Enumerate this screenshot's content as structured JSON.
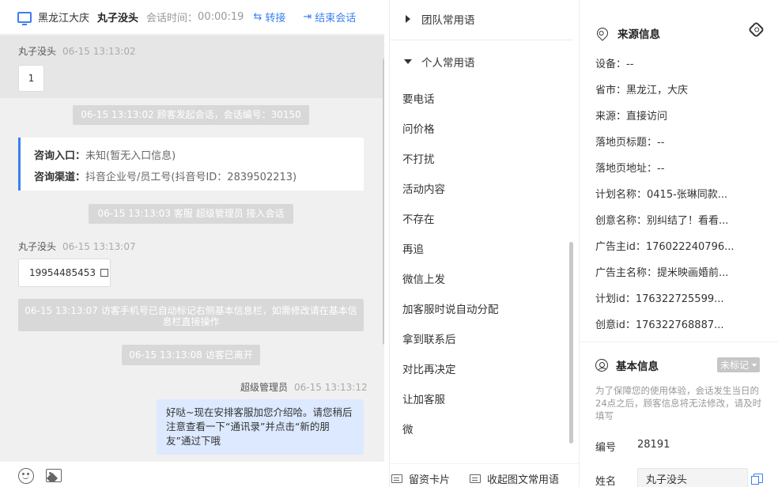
{
  "header": {
    "location": "黑龙江大庆",
    "visitor_name": "丸子没头",
    "time_label": "会话时间：",
    "time_value": "00:00:19",
    "transfer_label": "转接",
    "end_label": "结束会话"
  },
  "chat": {
    "msg1": {
      "sender": "丸子没头",
      "time": "06-15 13:13:02",
      "text": "1"
    },
    "sys1": "06-15 13:13:02 顾客发起会话，会话编号：30150",
    "info_card": {
      "entry_key": "咨询入口：",
      "entry_val": "未知(暂无入口信息)",
      "channel_key": "咨询渠道：",
      "channel_val": "抖音企业号/员工号(抖音号ID：2839502213)"
    },
    "sys2": "06-15 13:13:03 客服 超级管理员 接入会话",
    "msg2": {
      "sender": "丸子没头",
      "time": "06-15 13:13:07",
      "text": "19954485453"
    },
    "sys3": "06-15 13:13:07 访客手机号已自动标记右侧基本信息栏，如需修改请在基本信息栏直接操作",
    "sys4": "06-15 13:13:08 访客已离开",
    "msg3": {
      "sender": "超级管理员",
      "time": "06-15 13:13:12",
      "text": "好哒~现在安排客服加您介绍哈。请您稍后注意查看一下“通讯录”并点击“新的朋友”通过下哦"
    }
  },
  "phrases": {
    "team_label": "团队常用语",
    "personal_label": "个人常用语",
    "items": [
      "要电话",
      "问价格",
      "不打扰",
      "活动内容",
      "不存在",
      "再追",
      "微信上发",
      "加客服时说自动分配",
      "拿到联系后",
      "对比再决定",
      "让加客服",
      "微"
    ],
    "footer_card": "留资卡片",
    "footer_collect": "收起图文常用语"
  },
  "info": {
    "source_title": "来源信息",
    "source_rows": [
      "设备：--",
      "省市：黑龙江，大庆",
      "来源：直接访问",
      "落地页标题：--",
      "落地页地址：--",
      "计划名称：0415-张琳同款...",
      "创意名称：别纠结了！看看...",
      "广告主id：176022240796...",
      "广告主名称：提米映画婚前...",
      "计划id：176322725599...",
      "创意id：176322768887..."
    ],
    "basic_title": "基本信息",
    "tag_label": "未标记",
    "note": "为了保障您的使用体验，会话发生当日的24点之后，顾客信息将无法修改，请及时填写",
    "id_label": "编号",
    "id_value": "28191",
    "name_label": "姓名",
    "name_value": "丸子没头"
  },
  "colors": {
    "accent": "#3a7ff0",
    "agent_bubble": "#dce9ff",
    "system_msg": "#d8d8d8"
  }
}
